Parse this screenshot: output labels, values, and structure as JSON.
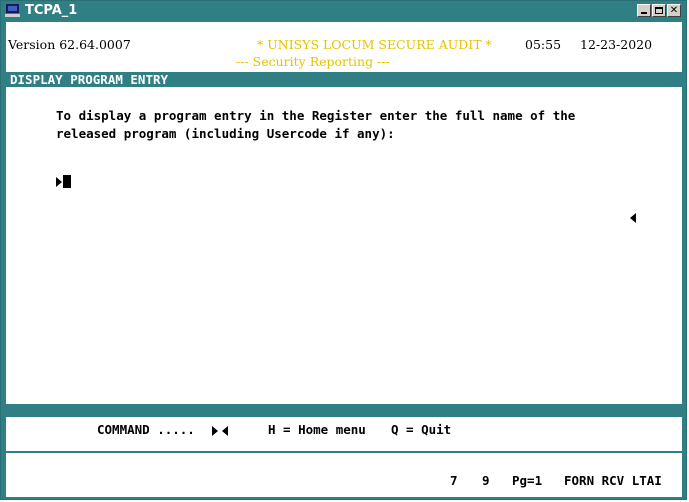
{
  "window": {
    "title": "TCPA_1"
  },
  "header": {
    "version": "Version 62.64.0007",
    "audit_title": "* UNISYS LOCUM SECURE AUDIT *",
    "subtitle": "--- Security Reporting ---",
    "time": "05:55",
    "date": "12-23-2020"
  },
  "section": {
    "title": "DISPLAY PROGRAM ENTRY"
  },
  "prompt": {
    "line1": "To display a program entry in the Register enter the full name of the",
    "line2": "released program (including Usercode if any):"
  },
  "command_bar": {
    "label": "COMMAND .....",
    "home_hint": "H = Home menu",
    "quit_hint": "Q = Quit"
  },
  "status_bar": {
    "row": "7",
    "col": "9",
    "page": "Pg=1",
    "mode": "FORN RCV LTAI"
  },
  "icons": [
    "terminal-app-icon",
    "minimize-icon",
    "maximize-icon",
    "close-icon",
    "cursor-marker-icon",
    "field-end-marker-icon"
  ],
  "colors": {
    "teal": "#2f7f84",
    "audit_yellow": "#e6c200"
  }
}
